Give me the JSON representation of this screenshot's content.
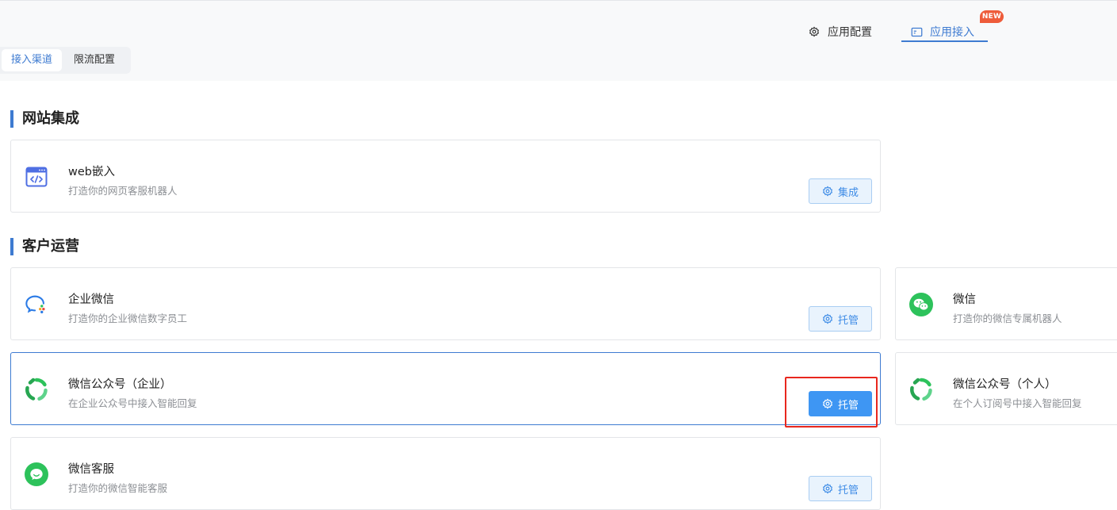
{
  "header": {
    "tabs": [
      {
        "label": "应用配置",
        "icon": "gear-icon"
      },
      {
        "label": "应用接入",
        "icon": "monitor-icon",
        "badge": "NEW",
        "active": true
      }
    ]
  },
  "subtabs": [
    {
      "label": "接入渠道",
      "active": true
    },
    {
      "label": "限流配置",
      "active": false
    }
  ],
  "sections": [
    {
      "title": "网站集成",
      "cards": [
        {
          "title": "web嵌入",
          "desc": "打造你的网页客服机器人",
          "button": "集成",
          "icon": "web-code-icon"
        }
      ]
    },
    {
      "title": "客户运营",
      "cards": [
        {
          "title": "企业微信",
          "desc": "打造你的企业微信数字员工",
          "button": "托管",
          "icon": "wecom-icon"
        },
        {
          "title": "微信",
          "desc": "打造你的微信专属机器人",
          "icon": "wechat-icon"
        },
        {
          "title": "微信公众号（企业）",
          "desc": "在企业公众号中接入智能回复",
          "button": "托管",
          "icon": "wechat-official-icon",
          "active": true
        },
        {
          "title": "微信公众号（个人）",
          "desc": "在个人订阅号中接入智能回复",
          "icon": "wechat-official-icon"
        },
        {
          "title": "微信客服",
          "desc": "打造你的微信智能客服",
          "button": "托管",
          "icon": "wechat-service-icon"
        }
      ]
    }
  ],
  "colors": {
    "accent": "#3e7bd1",
    "primary_button": "#3e96f3",
    "badge": "#ee5c3a",
    "wechat_green": "#2dc25b",
    "highlight": "#e8271e"
  }
}
